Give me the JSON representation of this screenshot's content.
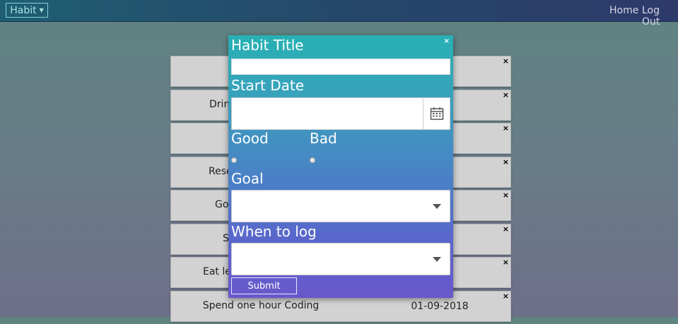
{
  "navbar": {
    "brand_label": "Habit",
    "home_label": "Home",
    "logout_label": "Log Out"
  },
  "habits": [
    {
      "title": "",
      "date": ""
    },
    {
      "title": "Drink",
      "date": ""
    },
    {
      "title": "",
      "date": ""
    },
    {
      "title": "Rese",
      "date": ""
    },
    {
      "title": "Go",
      "date": ""
    },
    {
      "title": "S",
      "date": ""
    },
    {
      "title": "Eat les",
      "date": ""
    },
    {
      "title": "Spend one hour Coding",
      "date": "01-09-2018"
    }
  ],
  "modal": {
    "habit_title_label": "Habit Title",
    "start_date_label": "Start Date",
    "good_label": "Good",
    "bad_label": "Bad",
    "goal_label": "Goal",
    "when_to_log_label": "When to log",
    "submit_label": "Submit",
    "close_glyph": "×",
    "delete_glyph": "×",
    "calendar_icon": "calendar-icon"
  }
}
